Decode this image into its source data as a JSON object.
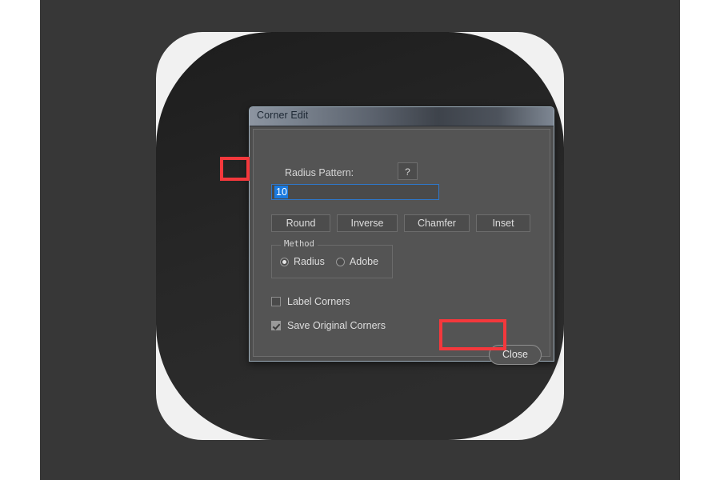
{
  "app": {
    "canvas_background": "#373737",
    "page_background": "#ffffff",
    "artwork_shape_color": "#232323",
    "artwork_corner_color": "#f1f1f1"
  },
  "dialog": {
    "title": "Corner Edit",
    "radius_pattern": {
      "label": "Radius Pattern:",
      "help_label": "?",
      "value": "10",
      "placeholder": "",
      "selected": true,
      "border_color": "#2f77c9",
      "selection_color": "#1a7ae0"
    },
    "action_buttons": [
      {
        "label": "Round"
      },
      {
        "label": "Inverse"
      },
      {
        "label": "Chamfer"
      },
      {
        "label": "Inset"
      }
    ],
    "method_group": {
      "legend": "Method",
      "options": [
        {
          "label": "Radius",
          "selected": true
        },
        {
          "label": "Adobe",
          "selected": false
        }
      ]
    },
    "checkboxes": [
      {
        "label": "Label Corners",
        "checked": false
      },
      {
        "label": "Save Original Corners",
        "checked": true
      }
    ],
    "close_button": {
      "label": "Close"
    }
  },
  "annotations": {
    "highlight_color": "#f4383c",
    "boxes": [
      {
        "name": "radius-input-highlight"
      },
      {
        "name": "close-button-highlight"
      }
    ]
  }
}
